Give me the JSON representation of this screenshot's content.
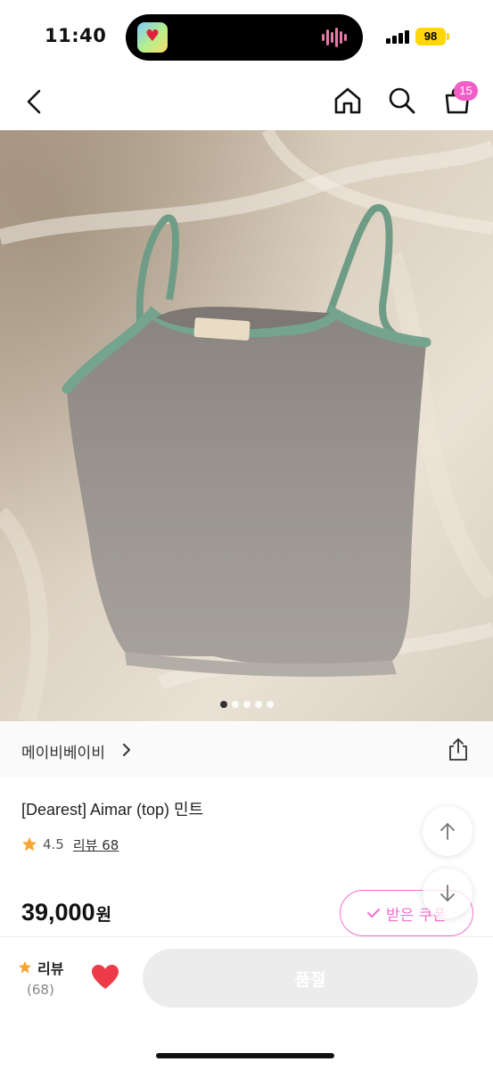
{
  "status_bar": {
    "time": "11:40",
    "battery": "98",
    "icons": [
      "signal-icon",
      "battery-icon"
    ]
  },
  "nav": {
    "icons": [
      "back-icon",
      "home-icon",
      "search-icon",
      "cart-icon"
    ],
    "cart_count": "15"
  },
  "product": {
    "image_description_icon": "product-photo",
    "image_count": 5,
    "active_image_index": 0,
    "shop_name": "메이비베이비",
    "title": "[Dearest] Aimar (top) 민트",
    "rating": "4.5",
    "review_link": "리뷰 68",
    "price": "39,000",
    "price_unit": "원",
    "coupon_label": "받은 쿠폰"
  },
  "bottom_bar": {
    "review_label": "리뷰",
    "review_count": "(68)",
    "buy_label": "품절"
  },
  "colors": {
    "accent": "#f36fcf",
    "badge": "#f25ec7",
    "heart": "#ee3b4a",
    "star": "#f7a530",
    "soldout_bg": "#ececec"
  }
}
